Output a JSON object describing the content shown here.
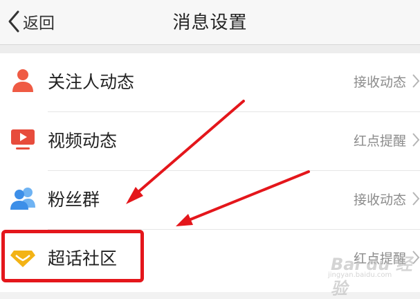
{
  "header": {
    "back_label": "返回",
    "title": "消息设置"
  },
  "settings": [
    {
      "label": "关注人动态",
      "value": "接收动态",
      "icon": "person-icon",
      "color": "#ef5b44"
    },
    {
      "label": "视频动态",
      "value": "红点提醒",
      "icon": "video-play-icon",
      "color": "#e74c3c"
    },
    {
      "label": "粉丝群",
      "value": "接收动态",
      "icon": "group-icon",
      "color": "#3d8fe8"
    },
    {
      "label": "超话社区",
      "value": "红点提醒",
      "icon": "diamond-icon",
      "color": "#f3b315"
    }
  ],
  "watermark": {
    "main": "Bai du 经验",
    "sub": "jingyan.baidu.com"
  },
  "annotation": {
    "highlight_color": "#e4161b"
  }
}
